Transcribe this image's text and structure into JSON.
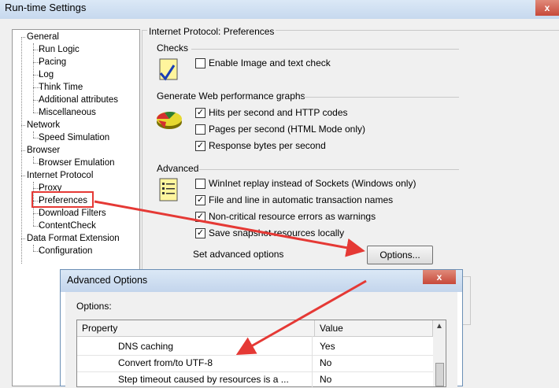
{
  "window": {
    "title": "Run-time Settings",
    "close_glyph": "x"
  },
  "tree": {
    "items": [
      {
        "label": "General",
        "level": 0
      },
      {
        "label": "Run Logic",
        "level": 1
      },
      {
        "label": "Pacing",
        "level": 1
      },
      {
        "label": "Log",
        "level": 1
      },
      {
        "label": "Think Time",
        "level": 1
      },
      {
        "label": "Additional attributes",
        "level": 1
      },
      {
        "label": "Miscellaneous",
        "level": 1
      },
      {
        "label": "Network",
        "level": 0
      },
      {
        "label": "Speed Simulation",
        "level": 1
      },
      {
        "label": "Browser",
        "level": 0
      },
      {
        "label": "Browser Emulation",
        "level": 1
      },
      {
        "label": "Internet Protocol",
        "level": 0
      },
      {
        "label": "Proxy",
        "level": 1
      },
      {
        "label": "Preferences",
        "level": 1,
        "selected": true
      },
      {
        "label": "Download Filters",
        "level": 1
      },
      {
        "label": "ContentCheck",
        "level": 1
      },
      {
        "label": "Data Format Extension",
        "level": 0
      },
      {
        "label": "Configuration",
        "level": 1
      }
    ]
  },
  "panel": {
    "group_title": "Internet Protocol: Preferences",
    "checks": {
      "title": "Checks",
      "icon": "checklist-icon",
      "options": [
        {
          "label": "Enable Image and text check",
          "checked": false
        }
      ]
    },
    "graphs": {
      "title": "Generate Web performance graphs",
      "icon": "pie-chart-icon",
      "options": [
        {
          "label": "Hits per second and HTTP codes",
          "checked": true
        },
        {
          "label": "Pages per second (HTML Mode only)",
          "checked": false
        },
        {
          "label": "Response bytes per second",
          "checked": true
        }
      ]
    },
    "advanced": {
      "title": "Advanced",
      "icon": "notepad-icon",
      "options": [
        {
          "label": "WinInet replay instead of Sockets (Windows only)",
          "checked": false
        },
        {
          "label": "File and line in automatic transaction names",
          "checked": true
        },
        {
          "label": "Non-critical resource errors as warnings",
          "checked": true
        },
        {
          "label": "Save snapshot resources locally",
          "checked": true
        }
      ],
      "set_label": "Set advanced options",
      "options_button": "Options..."
    }
  },
  "dialog": {
    "title": "Advanced Options",
    "options_label": "Options:",
    "columns": [
      "Property",
      "Value"
    ],
    "rows": [
      {
        "property": "DNS caching",
        "value": "Yes"
      },
      {
        "property": "Convert from/to UTF-8",
        "value": "No"
      },
      {
        "property": "Step timeout caused by resources is a ...",
        "value": "No"
      }
    ]
  },
  "colors": {
    "highlight_box": "#e53935",
    "arrow": "#e53935"
  }
}
